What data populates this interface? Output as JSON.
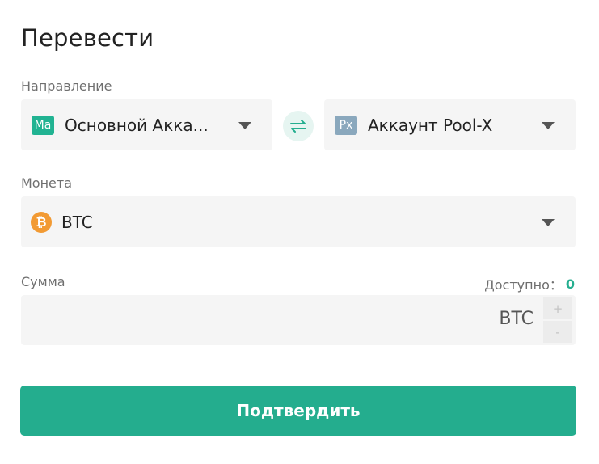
{
  "page": {
    "title": "Перевести"
  },
  "direction": {
    "label": "Направление",
    "from": {
      "badge": "Ma",
      "text": "Основной Акка..."
    },
    "to": {
      "badge": "Px",
      "text": "Аккаунт Pool-X"
    }
  },
  "coin": {
    "label": "Монета",
    "icon_text": "₿",
    "value": "BTC"
  },
  "amount": {
    "label": "Сумма",
    "available_label": "Доступно：",
    "available_value": "0",
    "value": "",
    "unit": "BTC",
    "plus": "+",
    "minus": "-"
  },
  "confirm": {
    "label": "Подтвердить"
  },
  "colors": {
    "accent": "#24ad8e",
    "badge_ma": "#21b392",
    "badge_px": "#8aa8bd",
    "btc": "#f29a33",
    "field_bg": "#f5f5f5"
  },
  "icons": {
    "swap": "swap-arrows-icon",
    "caret": "caret-down-icon",
    "coin": "bitcoin-icon"
  }
}
